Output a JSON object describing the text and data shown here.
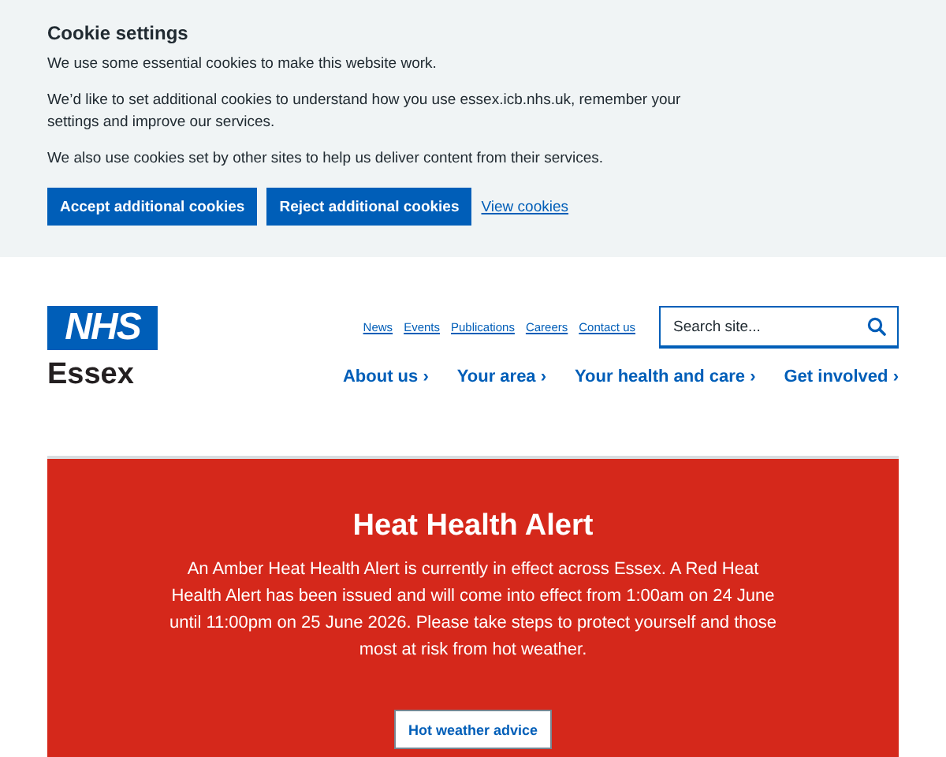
{
  "cookie_banner": {
    "title": "Cookie settings",
    "paragraphs": [
      "We use some essential cookies to make this website work.",
      "We’d like to set additional cookies to understand how you use essex.icb.nhs.uk, remember your settings and improve our services.",
      "We also use cookies set by other sites to help us deliver content from their services."
    ],
    "buttons": [
      "Accept additional cookies",
      "Reject additional cookies"
    ],
    "link": "View cookies"
  },
  "header": {
    "logo": {
      "badge": "NHS",
      "name": "Essex"
    },
    "utility_links": [
      "News",
      "Events",
      "Publications",
      "Careers",
      "Contact us"
    ],
    "search": {
      "placeholder": "Search site..."
    },
    "nav": [
      "About us ›",
      "Your area ›",
      "Your health and care ›",
      "Get involved ›"
    ]
  },
  "alert": {
    "title": "Heat Health Alert",
    "body": "An Amber Heat Health Alert is currently in effect across Essex. A Red Heat Health Alert has been issued and will come into effect from 1:00am on 24 June until 11:00pm on 25 June 2026. Please take steps to protect yourself and those most at risk from hot weather.",
    "button": "Hot weather advice"
  }
}
